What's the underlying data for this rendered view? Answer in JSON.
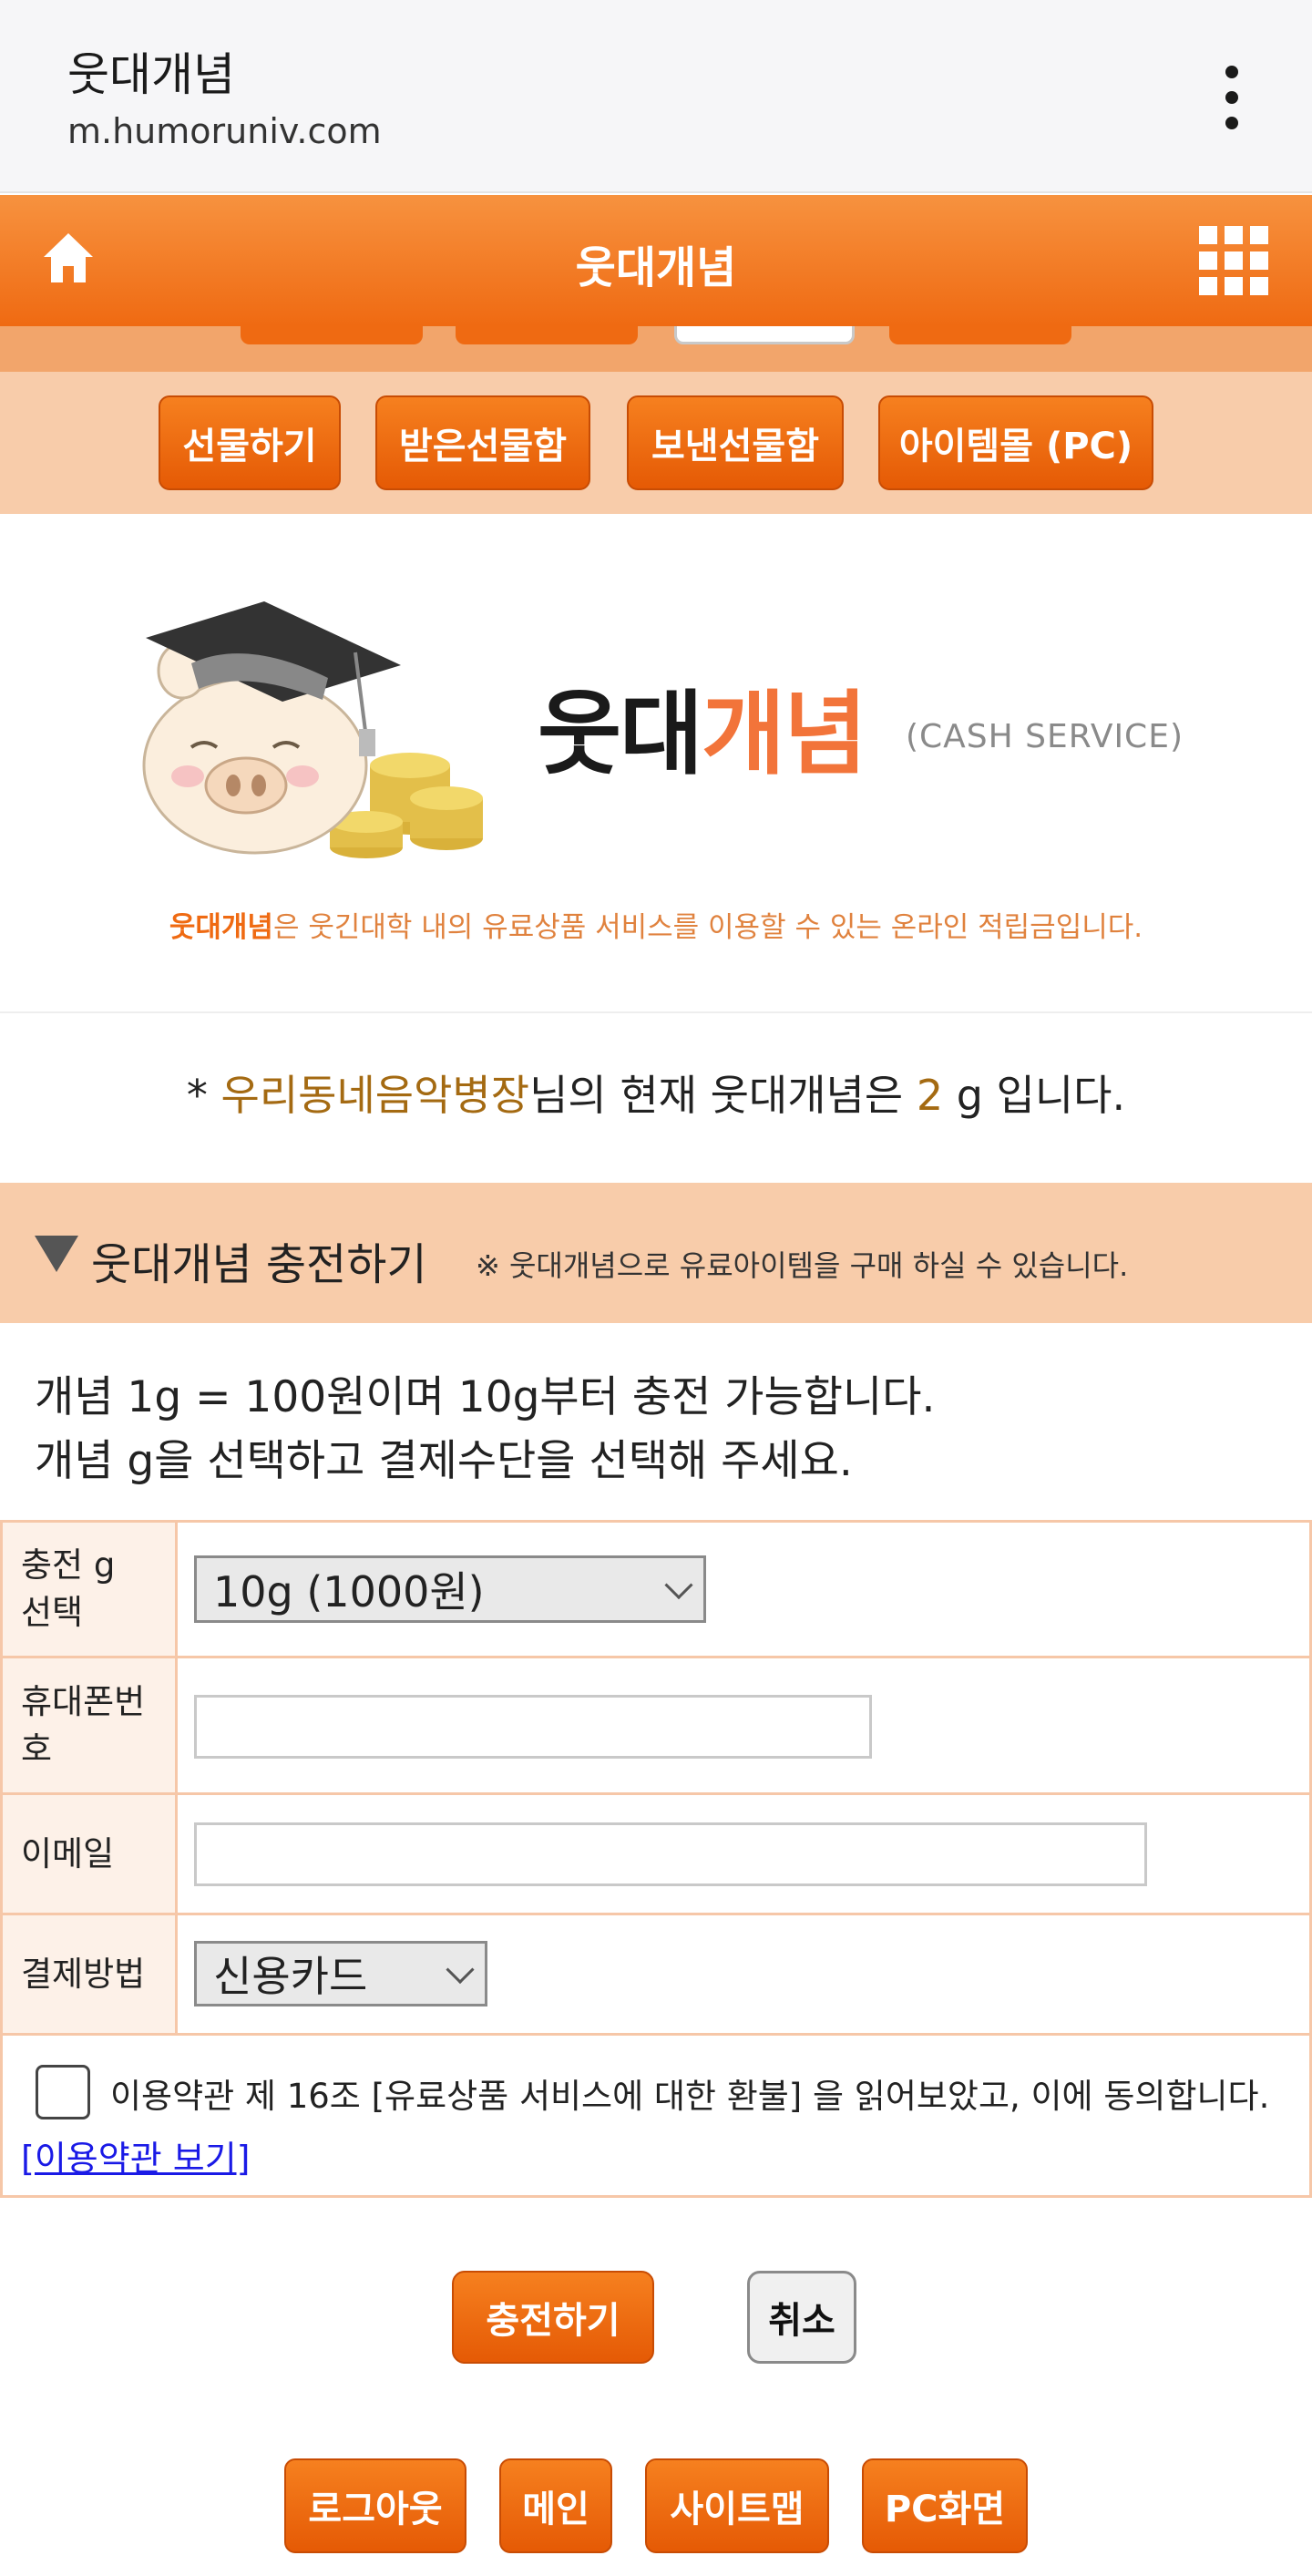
{
  "browser": {
    "title": "웃대개념",
    "url": "m.humoruniv.com"
  },
  "header": {
    "title": "웃대개념"
  },
  "subnav": [
    "선물하기",
    "받은선물함",
    "보낸선물함",
    "아이템몰 (PC)"
  ],
  "banner": {
    "logo_part1": "웃대",
    "logo_part2": "개념",
    "cash_label": "(CASH SERVICE)",
    "desc_bold": "웃대개념",
    "desc_rest": "은 웃긴대학 내의 유료상품 서비스를 이용할 수 있는 온라인 적립금입니다."
  },
  "balance": {
    "prefix": "* ",
    "nickname": "우리동네음악병장",
    "middle": "님의 현재 웃대개념은 ",
    "amount": "2",
    "suffix": " g 입니다."
  },
  "charge": {
    "title": "웃대개념 충전하기",
    "note": "※ 웃대개념으로 유료아이템을 구매 하실 수 있습니다.",
    "info_line1": "개념 1g = 100원이며 10g부터 충전 가능합니다.",
    "info_line2": "개념 g을 선택하고 결제수단을 선택해 주세요."
  },
  "form": {
    "amount_label": "충전 g 선택",
    "amount_value": "10g (1000원)",
    "phone_label": "휴대폰번호",
    "phone_value": "",
    "email_label": "이메일",
    "email_value": "",
    "payment_label": "결제방법",
    "payment_value": "신용카드",
    "agree_text": "이용약관 제 16조 [유료상품 서비스에 대한 환불] 을 읽어보았고, 이에 동의합니다.",
    "terms_link": "[이용약관 보기]",
    "agree_checked": false
  },
  "buttons": {
    "submit": "충전하기",
    "cancel": "취소"
  },
  "footer": [
    "로그아웃",
    "메인",
    "사이트맵",
    "PC화면"
  ],
  "colors": {
    "accent": "#ef6a12",
    "light_accent": "#f8ccaa",
    "amount": "#a46a12"
  }
}
